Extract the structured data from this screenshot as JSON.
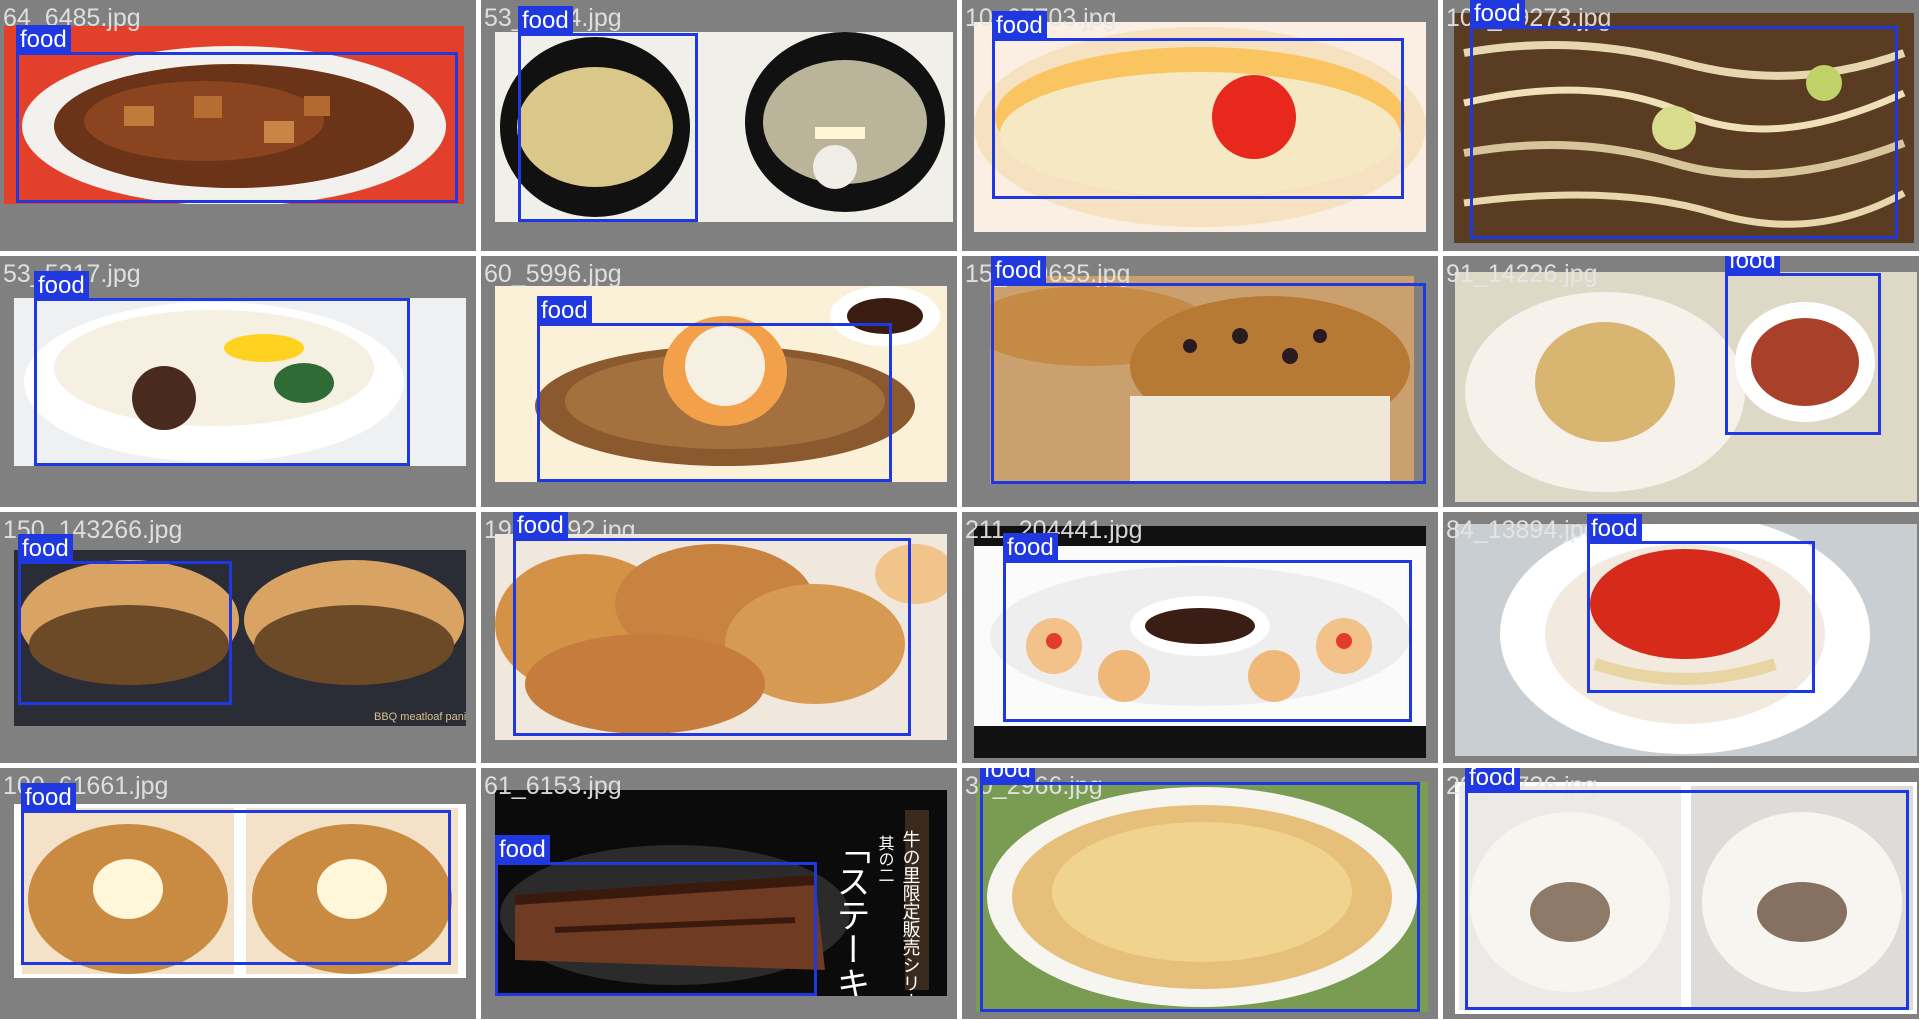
{
  "mosaic": {
    "tiles": [
      {
        "filename": "64_6485.jpg",
        "label": "food",
        "subject": "mapo-tofu"
      },
      {
        "filename": "53_5504.jpg",
        "label": "food",
        "subject": "soup-bowls"
      },
      {
        "filename": "10_67703.jpg",
        "label": "food",
        "subject": "chawanmushi"
      },
      {
        "filename": "109_69273.jpg",
        "label": "food",
        "subject": "fried-noodles"
      },
      {
        "filename": "53_5317.jpg",
        "label": "food",
        "subject": "chawanmushi-bowl"
      },
      {
        "filename": "60_5996.jpg",
        "label": "food",
        "subject": "hamburg-steak"
      },
      {
        "filename": "15_149635.jpg",
        "label": "food",
        "subject": "muffin"
      },
      {
        "filename": "91_14226.jpg",
        "label": "food",
        "subject": "fried-rice-soup"
      },
      {
        "filename": "150_143266.jpg",
        "label": "food",
        "subject": "panini"
      },
      {
        "filename": "19_19292.jpg",
        "label": "food",
        "subject": "fried-chicken"
      },
      {
        "filename": "211_204441.jpg",
        "label": "food",
        "subject": "appetizer-platter"
      },
      {
        "filename": "84_13894.jpg",
        "label": "food",
        "subject": "spaghetti"
      },
      {
        "filename": "100_61661.jpg",
        "label": "food",
        "subject": "cream-puff"
      },
      {
        "filename": "61_6153.jpg",
        "label": "food",
        "subject": "steak"
      },
      {
        "filename": "30_2966.jpg",
        "label": "food",
        "subject": "gratin"
      },
      {
        "filename": "29_27726.jpg",
        "label": "food",
        "subject": "steamed-buns"
      }
    ],
    "embedded_text": {
      "tile14_vertical_1": "牛の里限定販売シリーズ",
      "tile14_vertical_2": "其の二",
      "tile14_title": "「ステーキ」",
      "tile9_caption": "BBQ meatloaf panini"
    },
    "colors": {
      "background": "#808080",
      "box": "#1f38e0",
      "label_text": "#ffffff"
    }
  }
}
